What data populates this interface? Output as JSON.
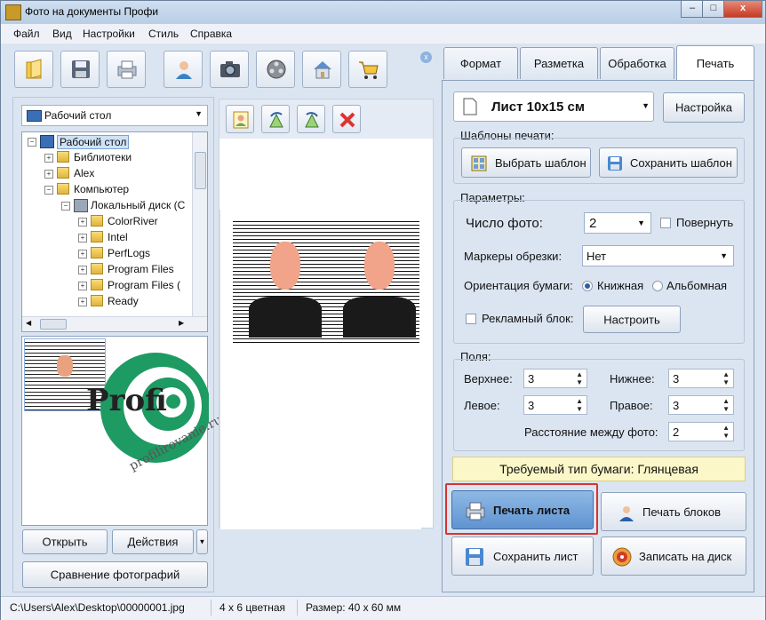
{
  "window": {
    "title": "Фото на документы Профи",
    "controls": [
      "–",
      "□",
      "x"
    ]
  },
  "menu": [
    "Файл",
    "Вид",
    "Настройки",
    "Стиль",
    "Справка"
  ],
  "toolbar": {
    "buttons": [
      "open-folder-icon",
      "save-disk-icon",
      "printer-icon",
      "person-photo-icon",
      "camera-icon",
      "film-reel-icon",
      "home-icon",
      "shopping-cart-icon"
    ],
    "close_glyph": "x"
  },
  "browser": {
    "location": "Рабочий стол",
    "tree": [
      {
        "label": "Рабочий стол",
        "level": 0,
        "exp": "−",
        "selected": true
      },
      {
        "label": "Библиотеки",
        "level": 1,
        "exp": "+"
      },
      {
        "label": "Alex",
        "level": 1,
        "exp": "+"
      },
      {
        "label": "Компьютер",
        "level": 1,
        "exp": "−"
      },
      {
        "label": "Локальный диск (C",
        "level": 2,
        "exp": "−"
      },
      {
        "label": "ColorRiver",
        "level": 3,
        "exp": "+"
      },
      {
        "label": "Intel",
        "level": 3,
        "exp": "+"
      },
      {
        "label": "PerfLogs",
        "level": 3,
        "exp": "+"
      },
      {
        "label": "Program Files",
        "level": 3,
        "exp": "+"
      },
      {
        "label": "Program Files (",
        "level": 3,
        "exp": "+"
      },
      {
        "label": "Ready",
        "level": 3,
        "exp": "+"
      }
    ],
    "open_button": "Открыть",
    "actions_button": "Действия",
    "compare_button": "Сравнение фотографий"
  },
  "watermark": {
    "brand": "Profi",
    "site": "profilirovanie.ru"
  },
  "preview_tools": [
    "portrait-icon",
    "rotate-left-icon",
    "rotate-right-icon",
    "delete-icon"
  ],
  "tabs": [
    "Формат",
    "Разметка",
    "Обработка",
    "Печать"
  ],
  "print": {
    "sheet": "Лист 10x15 см",
    "settings_button": "Настройка",
    "templates_label": "Шаблоны печати:",
    "choose_template": "Выбрать шаблон",
    "save_template": "Сохранить шаблон",
    "params_label": "Параметры:",
    "photo_count_label": "Число фото:",
    "photo_count": "2",
    "rotate_label": "Повернуть",
    "crop_marks_label": "Маркеры обрезки:",
    "crop_marks": "Нет",
    "orientation_label": "Ориентация бумаги:",
    "portrait": "Книжная",
    "landscape": "Альбомная",
    "ad_block_label": "Рекламный блок:",
    "configure_button": "Настроить",
    "margins_label": "Поля:",
    "top_label": "Верхнее:",
    "top": "3",
    "bottom_label": "Нижнее:",
    "bottom": "3",
    "left_label": "Левое:",
    "left": "3",
    "right_label": "Правое:",
    "right": "3",
    "gap_label": "Расстояние между фото:",
    "gap": "2",
    "paper_notice": "Требуемый тип бумаги: Глянцевая",
    "print_sheet": "Печать листа",
    "print_blocks": "Печать блоков",
    "save_sheet": "Сохранить лист",
    "burn_disk": "Записать на диск"
  },
  "statusbar": {
    "path": "C:\\Users\\Alex\\Desktop\\00000001.jpg",
    "mode": "4 x 6 цветная",
    "size": "Размер: 40 x 60 мм"
  },
  "colors": {
    "highlight": "#d63434",
    "print_button": "#5f93d0",
    "notice_bg": "#fbf7c8"
  }
}
